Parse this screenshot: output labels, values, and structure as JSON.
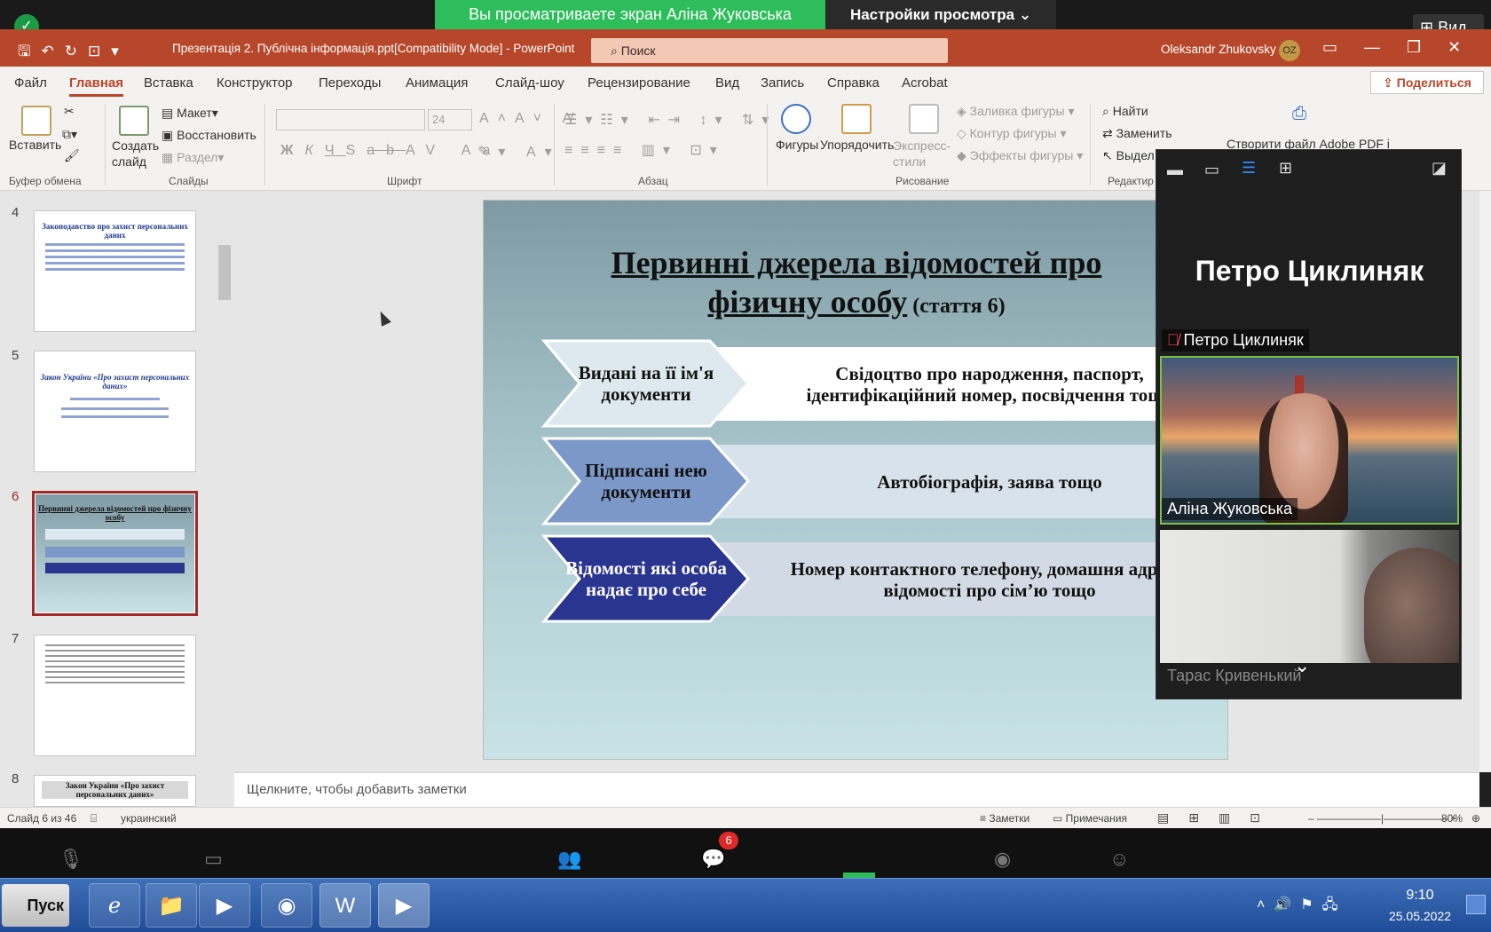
{
  "zoom_top": {
    "share_banner": "Вы просматриваете экран Аліна Жуковська",
    "view_settings": "Настройки просмотра ⌄",
    "view_button": "⊞ Вид"
  },
  "ppt_titlebar": {
    "doc_title": "Презентація 2. Публічна інформація.ppt[Compatibility Mode]  -  PowerPoint",
    "search_placeholder": "Поиск",
    "user_name": "Oleksandr Zhukovsky",
    "user_initials": "OZ"
  },
  "ribbon_tabs": [
    "Файл",
    "Главная",
    "Вставка",
    "Конструктор",
    "Переходы",
    "Анимация",
    "Слайд-шоу",
    "Рецензирование",
    "Вид",
    "Запись",
    "Справка",
    "Acrobat"
  ],
  "share_label": "Поделиться",
  "ribbon": {
    "clipboard": {
      "paste": "Вставить",
      "label": "Буфер обмена"
    },
    "slides": {
      "new_slide": "Создать слайд",
      "layout": "Макет",
      "reset": "Восстановить",
      "section": "Раздел",
      "label": "Слайды"
    },
    "font": {
      "size": "24",
      "label": "Шрифт"
    },
    "paragraph": {
      "label": "Абзац"
    },
    "drawing": {
      "shapes": "Фигуры",
      "arrange": "Упорядочить",
      "quick_styles": "Экспресс-стили",
      "fill": "Заливка фигуры",
      "outline": "Контур фигуры",
      "effects": "Эффекты фигуры",
      "label": "Рисование"
    },
    "editing": {
      "find": "Найти",
      "replace": "Заменить",
      "select": "Выдел",
      "label": "Редактир"
    },
    "adobe": {
      "create_pdf": "Створити файл Adobe PDF і"
    }
  },
  "thumbnails": [
    {
      "num": "4",
      "title": "Законодавство про захист персональних даних"
    },
    {
      "num": "5",
      "title": "Закон України «Про захист персональних даних»"
    },
    {
      "num": "6",
      "title": "Первинні джерела відомостей про фізичну особу"
    },
    {
      "num": "7",
      "title": ""
    },
    {
      "num": "8",
      "title": "Закон України «Про захист персональних даних»"
    }
  ],
  "slide": {
    "title_line1": "Первинні джерела відомостей про",
    "title_line2": "фізичну особу",
    "title_article": " (стаття 6)",
    "rows": [
      {
        "left": "Видані на її ім'я документи",
        "right": "Свідоцтво про народження, паспорт, ідентифікаційний номер, посвідчення тощо"
      },
      {
        "left": "Підписані нею документи",
        "right": "Автобіографія, заява тощо"
      },
      {
        "left": "Відомості які особа надає про себе",
        "right": "Номер контактного телефону, домашня адреса, відомості про сім’ю тощо"
      }
    ]
  },
  "notes_placeholder": "Щелкните, чтобы добавить заметки",
  "statusbar": {
    "slide_count": "Слайд 6 из 46",
    "language": "украинский",
    "notes": "Заметки",
    "comments": "Примечания",
    "zoom": "80%"
  },
  "gallery": {
    "speaker_big": "Петро Циклиняк",
    "tile1_label": "Петро Циклиняк",
    "tile2_label": "Аліна Жуковська",
    "tile3_label": "Тарас Кривенький"
  },
  "zoom_bottom": {
    "chat_badge": "6"
  },
  "taskbar": {
    "start": "Пуск",
    "time": "9:10",
    "date": "25.05.2022"
  },
  "colors": {
    "ppt_accent": "#b7472a",
    "zoom_green": "#2dbd5a"
  }
}
